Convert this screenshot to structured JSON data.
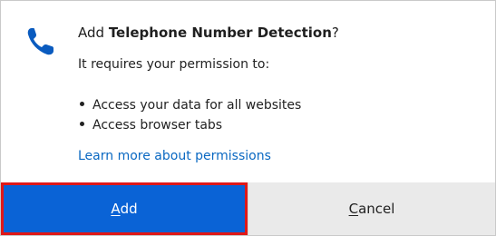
{
  "dialog": {
    "icon": "telephone-icon",
    "title_prefix": "Add ",
    "title_extension": "Telephone Number Detection",
    "title_suffix": "?",
    "subtitle": "It requires your permission to:",
    "permissions": [
      "Access your data for all websites",
      "Access browser tabs"
    ],
    "learn_more": "Learn more about permissions",
    "buttons": {
      "add": {
        "accel": "A",
        "rest": "dd"
      },
      "cancel": {
        "accel": "C",
        "rest": "ancel"
      }
    }
  },
  "colors": {
    "primary_button": "#0a63d6",
    "highlight_border": "#e01818",
    "link": "#0a68c2",
    "secondary_button": "#eaeaea"
  }
}
